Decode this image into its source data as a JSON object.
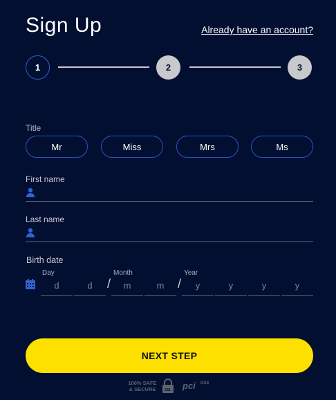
{
  "header": {
    "title": "Sign Up",
    "login_link": "Already have an account?"
  },
  "stepper": {
    "steps": [
      "1",
      "2",
      "3"
    ],
    "current_step": 1
  },
  "title_field": {
    "label": "Title",
    "options": [
      "Mr",
      "Miss",
      "Mrs",
      "Ms"
    ]
  },
  "first_name": {
    "label": "First name",
    "value": "",
    "icon": "person-icon"
  },
  "last_name": {
    "label": "Last name",
    "value": "",
    "icon": "person-icon"
  },
  "birth_date": {
    "label": "Birth date",
    "icon": "calendar-icon",
    "day_label": "Day",
    "month_label": "Month",
    "year_label": "Year",
    "day_placeholders": [
      "d",
      "d"
    ],
    "month_placeholders": [
      "m",
      "m"
    ],
    "year_placeholders": [
      "y",
      "y",
      "y",
      "y"
    ],
    "separator": "/"
  },
  "actions": {
    "next_label": "NEXT STEP"
  },
  "badges": {
    "safe_line1": "100% SAFE",
    "safe_line2": "& SECURE",
    "ssl_label": "SSL",
    "pci_label": "pci",
    "dss_label": "DSS"
  },
  "colors": {
    "background": "#020f31",
    "accent": "#2f63d6",
    "button": "#fde000"
  }
}
